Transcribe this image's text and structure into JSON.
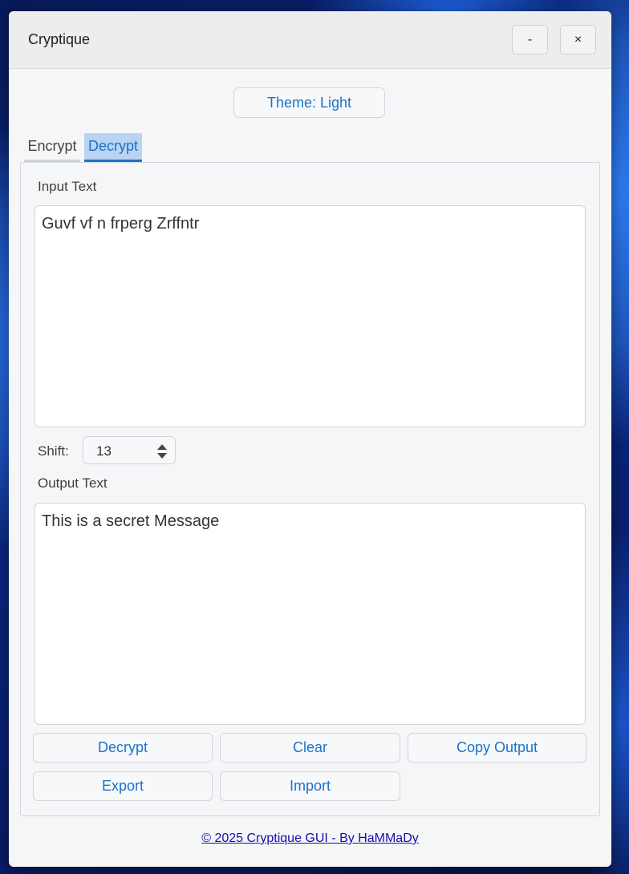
{
  "window": {
    "title": "Cryptique",
    "minimize_label": "-",
    "close_label": "×"
  },
  "theme_button": {
    "label": "Theme: Light"
  },
  "tabs": [
    {
      "label": "Encrypt",
      "selected": false
    },
    {
      "label": "Decrypt",
      "selected": true
    }
  ],
  "input": {
    "label": "Input Text",
    "value": "Guvf vf n frperg Zrffntr"
  },
  "shift": {
    "label": "Shift:",
    "value": "13"
  },
  "output": {
    "label": "Output Text",
    "value": "This is a secret Message"
  },
  "buttons": {
    "decrypt": "Decrypt",
    "clear": "Clear",
    "copy_output": "Copy Output",
    "export": "Export",
    "import": "Import"
  },
  "footer": {
    "text": "© 2025 Cryptique GUI - By HaMMaDy "
  },
  "colors": {
    "accent": "#1a73c8",
    "tab_selected_bg": "#b9d3f3",
    "window_bg": "#f5f6f8",
    "link": "#1a0dab"
  },
  "icons": {
    "spin_up": "caret-up-icon",
    "spin_down": "caret-down-icon"
  }
}
